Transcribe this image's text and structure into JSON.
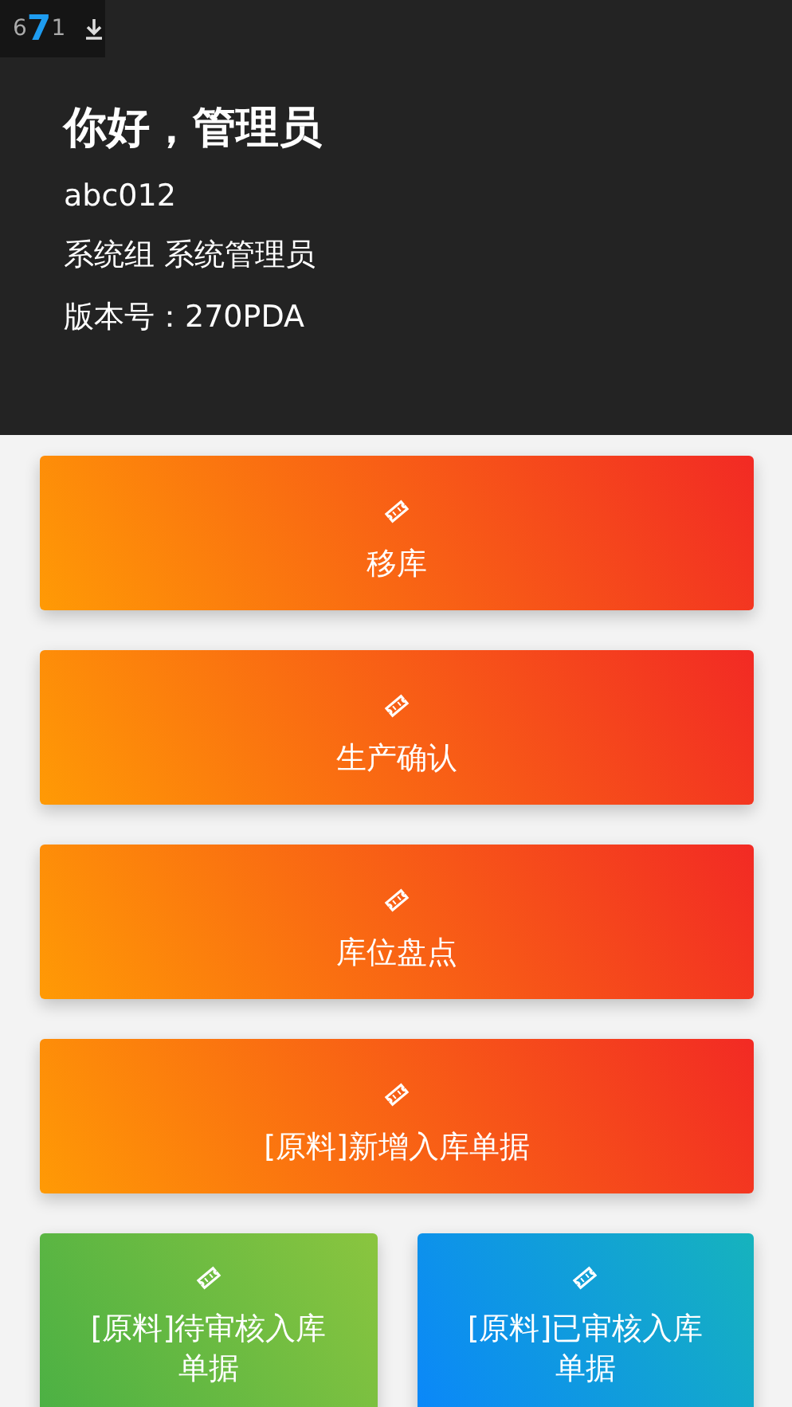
{
  "status_bar": {
    "texts": [
      "6",
      "7",
      "1"
    ]
  },
  "header": {
    "greeting": "你好，管理员",
    "lines": [
      "abc012",
      "系统组 系统管理员",
      "版本号：270PDA"
    ]
  },
  "menu": [
    {
      "label": "移库",
      "kind": "orange"
    },
    {
      "label": "生产确认",
      "kind": "orange"
    },
    {
      "label": "库位盘点",
      "kind": "orange"
    },
    {
      "label": "[原料]新增入库单据",
      "kind": "orange"
    }
  ],
  "menu_pairs": [
    {
      "label": "[原料]待审核入库单据",
      "kind": "green"
    },
    {
      "label": "[原料]已审核入库单据",
      "kind": "blue"
    }
  ]
}
